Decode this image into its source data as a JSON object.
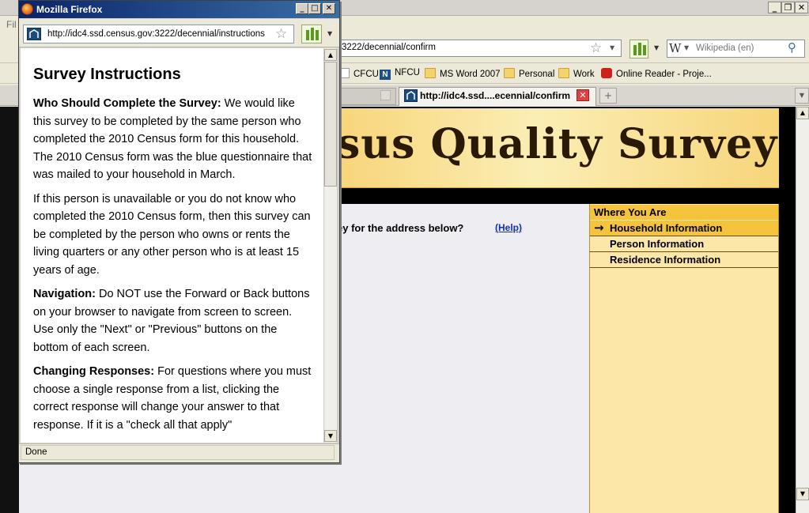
{
  "main_window": {
    "menu": {
      "file_partial": "Fil"
    },
    "url_partial": "3222/decennial/confirm",
    "search": {
      "placeholder": "Wikipedia (en)",
      "engine_glyph": "W"
    },
    "bookmarks": [
      {
        "label": "CFCU",
        "icon": "page-icon"
      },
      {
        "label": "NFCU",
        "icon": "n-icon"
      },
      {
        "label": "MS Word 2007",
        "icon": "folder-icon"
      },
      {
        "label": "Personal",
        "icon": "folder-icon"
      },
      {
        "label": "Work",
        "icon": "folder-icon"
      },
      {
        "label": "Online Reader - Proje...",
        "icon": "reader-icon"
      }
    ],
    "active_tab_label": "http://idc4.ssd....ecennial/confirm",
    "banner_title_partial": "sus Quality Survey",
    "question_partial": "ey for the address below?",
    "help_link": "(Help)",
    "sidebar": {
      "header": "Where You Are",
      "items": [
        {
          "label": "Household Information",
          "current": true
        },
        {
          "label": "Person Information",
          "current": false
        },
        {
          "label": "Residence Information",
          "current": false
        }
      ]
    },
    "colors": {
      "banner": "#f7d57a",
      "sidebar_bg": "#fce7a8",
      "sidebar_active": "#f5c43c",
      "link": "#1030c0"
    }
  },
  "popup": {
    "title": "Mozilla Firefox",
    "url": "http://idc4.ssd.census.gov:3222/decennial/instructions",
    "status": "Done",
    "heading": "Survey Instructions",
    "sections": [
      {
        "label": "Who Should Complete the Survey:",
        "text": " We would like this survey to be completed by the same person who completed the 2010 Census form for this household. The 2010 Census form was the blue questionnaire that was mailed to your household in March."
      },
      {
        "label": "",
        "text": "If this person is unavailable or you do not know who completed the 2010 Census form, then this survey can be completed by the person who owns or rents the living quarters or any other person who is at least 15 years of age."
      },
      {
        "label": "Navigation:",
        "text": " Do NOT use the Forward or Back buttons on your browser to navigate from screen to screen. Use only the \"Next\" or \"Previous\" buttons on the bottom of each screen."
      },
      {
        "label": "Changing Responses:",
        "text": " For questions where you must choose a single response from a list, clicking the correct response will change your answer to that response. If it is a \"check all that apply\""
      }
    ]
  }
}
